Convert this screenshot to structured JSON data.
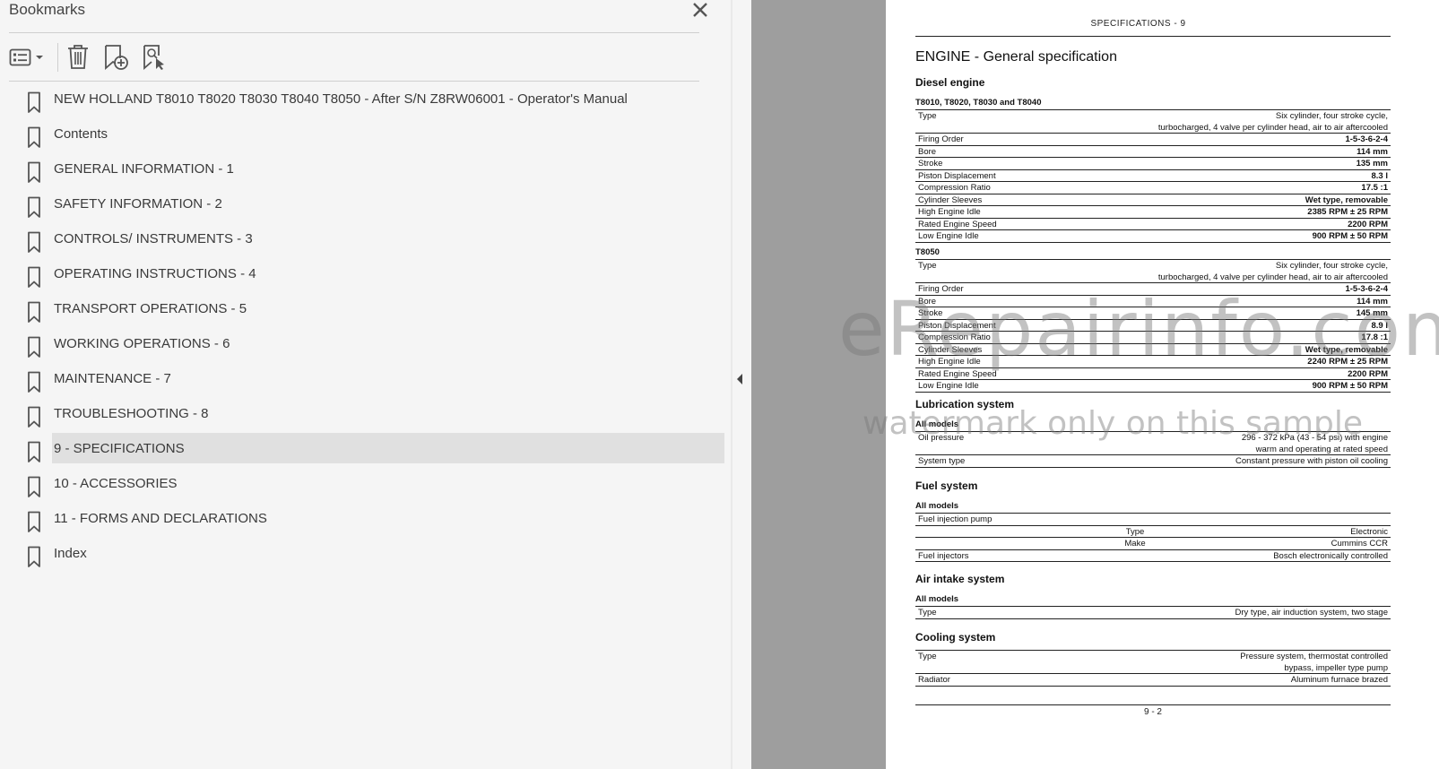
{
  "panel": {
    "title": "Bookmarks",
    "toolbar": {
      "options_icon": "list-options-icon",
      "delete_icon": "trash-icon",
      "new_icon": "new-bookmark-icon",
      "find_icon": "find-bookmark-icon"
    },
    "items": [
      {
        "label": "NEW HOLLAND T8010 T8020 T8030 T8040 T8050 - After S/N Z8RW06001 - Operator's Manual"
      },
      {
        "label": "Contents"
      },
      {
        "label": "GENERAL INFORMATION - 1"
      },
      {
        "label": "SAFETY INFORMATION - 2"
      },
      {
        "label": "CONTROLS/ INSTRUMENTS - 3"
      },
      {
        "label": "OPERATING INSTRUCTIONS - 4"
      },
      {
        "label": "TRANSPORT OPERATIONS - 5"
      },
      {
        "label": "WORKING OPERATIONS - 6"
      },
      {
        "label": "MAINTENANCE - 7"
      },
      {
        "label": "TROUBLESHOOTING - 8"
      },
      {
        "label": "9 - SPECIFICATIONS",
        "selected": true
      },
      {
        "label": "10 - ACCESSORIES"
      },
      {
        "label": "11 - FORMS AND DECLARATIONS"
      },
      {
        "label": "Index"
      }
    ]
  },
  "document": {
    "header": "SPECIFICATIONS - 9",
    "title": "ENGINE - General specification",
    "diesel": {
      "heading": "Diesel engine",
      "group1": {
        "models": "T8010, T8020, T8030 and T8040",
        "type_label": "Type",
        "type_value_1": "Six cylinder, four stroke cycle,",
        "type_value_2": "turbocharged, 4 valve per cylinder head, air to air aftercooled",
        "rows": [
          {
            "label": "Firing Order",
            "value": "1-5-3-6-2-4"
          },
          {
            "label": "Bore",
            "value": "114 mm"
          },
          {
            "label": "Stroke",
            "value": "135 mm"
          },
          {
            "label": "Piston Displacement",
            "value": "8.3 l"
          },
          {
            "label": "Compression Ratio",
            "value": "17.5 :1"
          },
          {
            "label": "Cylinder Sleeves",
            "value": "Wet type, removable"
          },
          {
            "label": "High Engine Idle",
            "value": "2385 RPM ± 25 RPM"
          },
          {
            "label": "Rated Engine Speed",
            "value": "2200 RPM"
          },
          {
            "label": "Low Engine Idle",
            "value": "900 RPM ± 50 RPM"
          }
        ]
      },
      "group2": {
        "models": "T8050",
        "type_label": "Type",
        "type_value_1": "Six cylinder, four stroke cycle,",
        "type_value_2": "turbocharged, 4 valve per cylinder head, air to air aftercooled",
        "rows": [
          {
            "label": "Firing Order",
            "value": "1-5-3-6-2-4"
          },
          {
            "label": "Bore",
            "value": "114 mm"
          },
          {
            "label": "Stroke",
            "value": "145 mm"
          },
          {
            "label": "Piston Displacement",
            "value": "8.9 l"
          },
          {
            "label": "Compression Ratio",
            "value": "17.8 :1"
          },
          {
            "label": "Cylinder Sleeves",
            "value": "Wet type, removable"
          },
          {
            "label": "High Engine Idle",
            "value": "2240 RPM ± 25 RPM"
          },
          {
            "label": "Rated Engine Speed",
            "value": "2200 RPM"
          },
          {
            "label": "Low Engine Idle",
            "value": "900 RPM ± 50 RPM"
          }
        ]
      }
    },
    "lubrication": {
      "heading": "Lubrication system",
      "models": "All models",
      "oil_label": "Oil pressure",
      "oil_value_1": "296 - 372 kPa (43 - 54 psi) with engine",
      "oil_value_2": "warm and operating at rated speed",
      "system_label": "System type",
      "system_value": "Constant pressure with piston oil cooling"
    },
    "fuel": {
      "heading": "Fuel system",
      "models": "All models",
      "pump_label": "Fuel injection pump",
      "type_label": "Type",
      "type_value": "Electronic",
      "make_label": "Make",
      "make_value": "Cummins CCR",
      "injectors_label": "Fuel injectors",
      "injectors_value": "Bosch electronically controlled"
    },
    "air": {
      "heading": "Air intake system",
      "models": "All models",
      "type_label": "Type",
      "type_value": "Dry type, air induction system, two stage"
    },
    "cooling": {
      "heading": "Cooling system",
      "type_label": "Type",
      "type_value_1": "Pressure system, thermostat controlled",
      "type_value_2": "bypass, impeller type pump",
      "radiator_label": "Radiator",
      "radiator_value": "Aluminum furnace brazed"
    },
    "footer": "9 - 2",
    "watermark_1": "eRepairinfo.com",
    "watermark_2": "watermark only on this sample"
  }
}
